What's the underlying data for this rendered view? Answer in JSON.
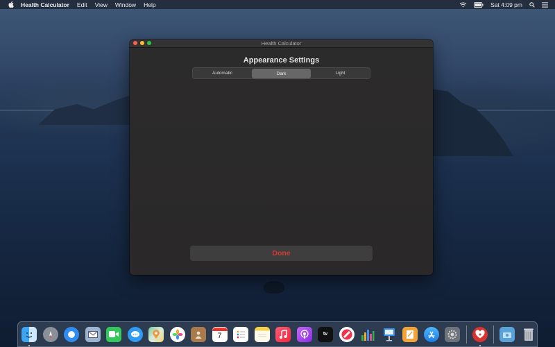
{
  "menubar": {
    "app_name": "Health Calculator",
    "items": [
      "Edit",
      "View",
      "Window",
      "Help"
    ],
    "clock": "Sat 4:09 pm",
    "status_icons": [
      "wifi-icon",
      "battery-icon",
      "search-icon",
      "control-center-icon"
    ]
  },
  "window": {
    "title": "Health Calculator",
    "heading": "Appearance Settings",
    "segments": [
      "Automatic",
      "Dark",
      "Light"
    ],
    "selected_segment": "Dark",
    "done_label": "Done",
    "accent_color": "#d23b32"
  },
  "dock": {
    "apps": [
      {
        "name": "finder-icon",
        "running": true
      },
      {
        "name": "launchpad-icon",
        "running": false
      },
      {
        "name": "safari-icon",
        "running": false
      },
      {
        "name": "mail-icon",
        "running": false
      },
      {
        "name": "facetime-icon",
        "running": false
      },
      {
        "name": "messages-icon",
        "running": false
      },
      {
        "name": "maps-icon",
        "running": false
      },
      {
        "name": "photos-icon",
        "running": false
      },
      {
        "name": "contacts-icon",
        "running": false
      },
      {
        "name": "calendar-icon",
        "running": false
      },
      {
        "name": "reminders-icon",
        "running": false
      },
      {
        "name": "notes-icon",
        "running": false
      },
      {
        "name": "music-icon",
        "running": false
      },
      {
        "name": "podcasts-icon",
        "running": false
      },
      {
        "name": "apple-tv-icon",
        "running": false
      },
      {
        "name": "news-icon",
        "running": false
      },
      {
        "name": "numbers-icon",
        "running": false
      },
      {
        "name": "keynote-icon",
        "running": false
      },
      {
        "name": "pages-icon",
        "running": false
      },
      {
        "name": "app-store-icon",
        "running": false
      },
      {
        "name": "system-preferences-icon",
        "running": false
      },
      {
        "name": "health-calculator-icon",
        "running": true
      }
    ],
    "calendar_day": "7",
    "trailing": [
      "screenshots-folder-icon",
      "trash-icon"
    ]
  }
}
